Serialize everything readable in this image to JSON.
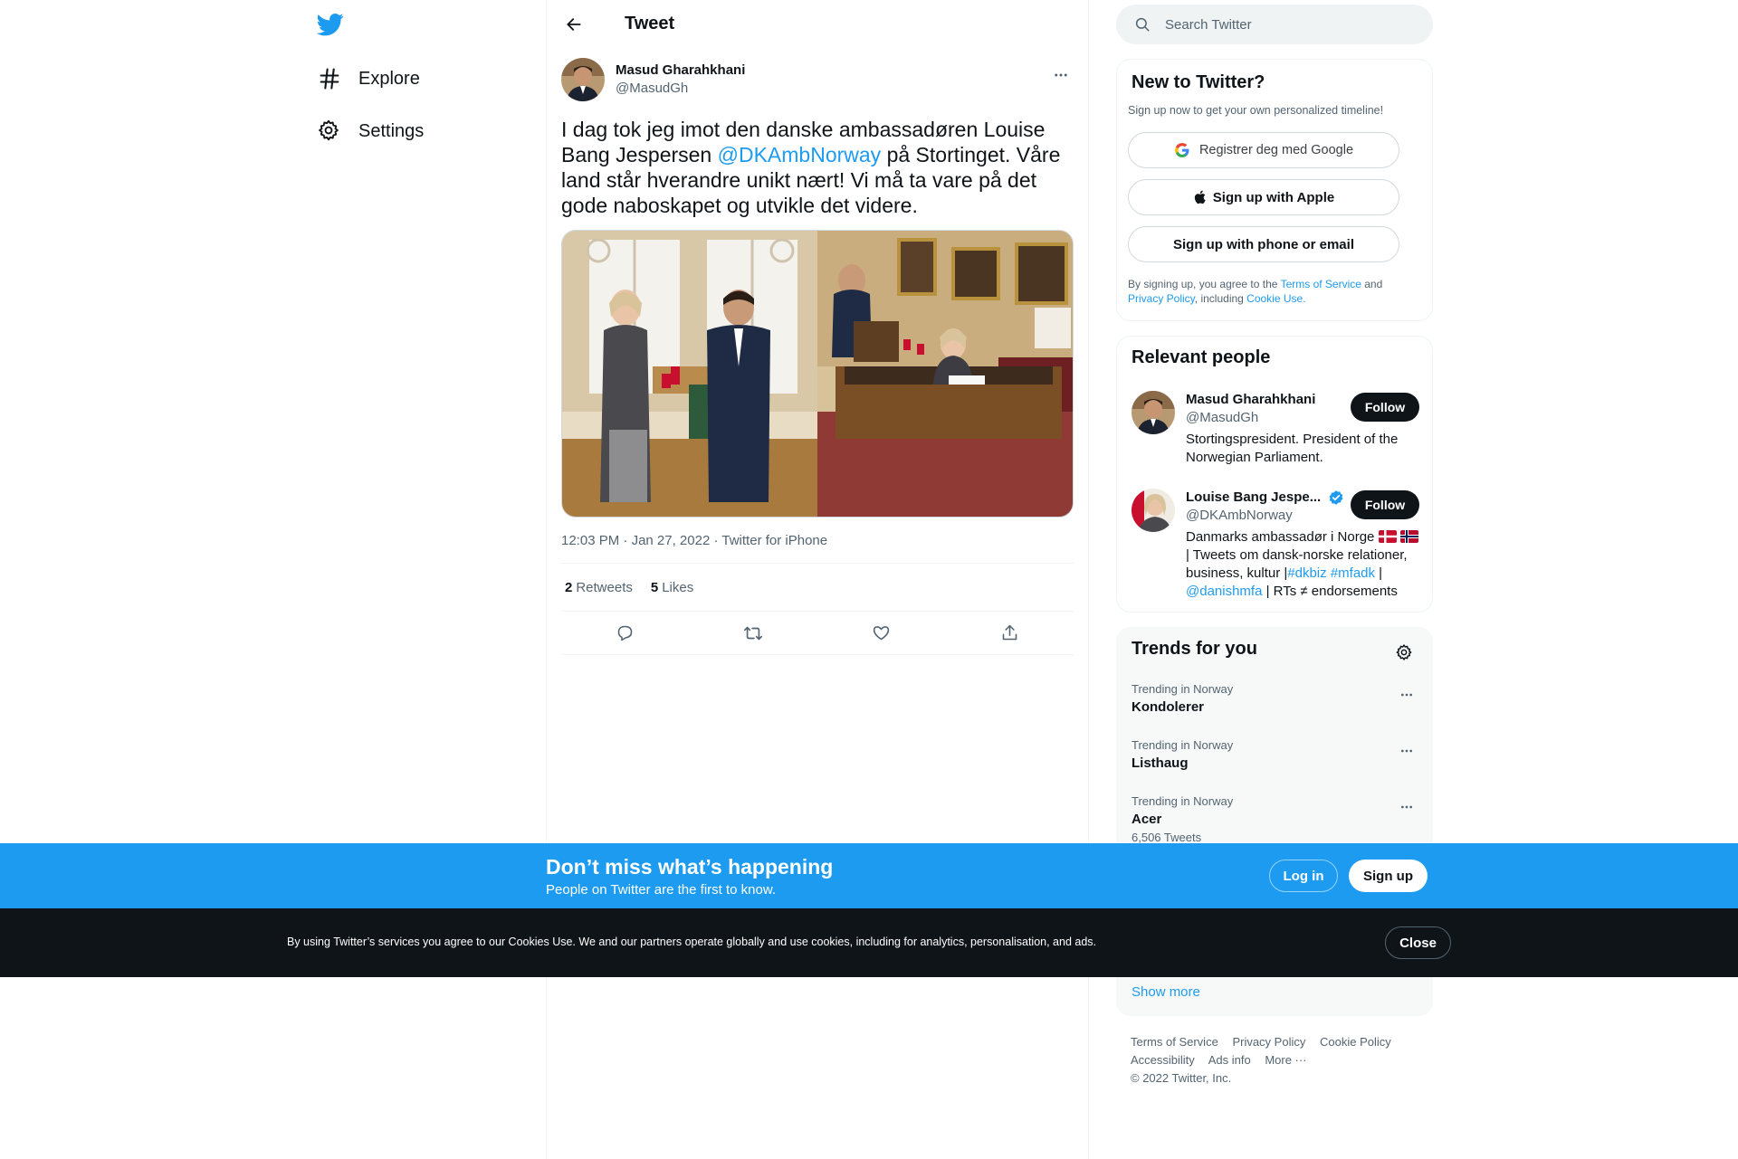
{
  "nav": {
    "logo_icon": "twitter-bird-icon",
    "items": [
      {
        "label": "Explore",
        "icon": "hashtag-icon"
      },
      {
        "label": "Settings",
        "icon": "gear-icon"
      }
    ]
  },
  "header": {
    "title": "Tweet"
  },
  "tweet": {
    "author_name": "Masud Gharahkhani",
    "author_handle": "@MasudGh",
    "text_before": "I dag tok jeg imot den danske ambassadøren Louise Bang Jespersen ",
    "mention": "@DKAmbNorway",
    "text_after": " på Stortinget. Våre land står hverandre unikt nært! Vi må ta vare på det gode naboskapet og utvikle det videre.",
    "time": "12:03 PM",
    "date": "Jan 27, 2022",
    "source": "Twitter for iPhone",
    "separator": "·",
    "retweets_count": "2",
    "retweets_label": "Retweets",
    "likes_count": "5",
    "likes_label": "Likes"
  },
  "search": {
    "placeholder": "Search Twitter"
  },
  "new_to_twitter": {
    "title": "New to Twitter?",
    "subtitle": "Sign up now to get your own personalized timeline!",
    "google_label": "Registrer deg med Google",
    "apple_label": "Sign up with Apple",
    "phone_label": "Sign up with phone or email",
    "legal_prefix": "By signing up, you agree to the ",
    "terms": "Terms of Service",
    "and": " and",
    "privacy": "Privacy Policy",
    "including": ", including ",
    "cookie_use": "Cookie Use."
  },
  "relevant_people": {
    "title": "Relevant people",
    "people": [
      {
        "name": "Masud Gharahkhani",
        "handle": "@MasudGh",
        "bio": "Stortingspresident. President of the Norwegian Parliament.",
        "follow": "Follow"
      },
      {
        "name": "Louise Bang Jespe...",
        "handle": "@DKAmbNorway",
        "bio_1": "Danmarks ambassadør i Norge",
        "bio_2": " | Tweets om dansk-norske relationer, business, kultur |",
        "tag_1": "#dkbiz",
        "tag_2": "#mfadk",
        "bio_3": " |",
        "mention": "@danishmfa",
        "bio_4": " | RTs ≠ endorsements",
        "follow": "Follow",
        "verified": true
      }
    ]
  },
  "trends": {
    "title": "Trends for you",
    "items": [
      {
        "context": "Trending in Norway",
        "name": "Kondolerer",
        "count": ""
      },
      {
        "context": "Trending in Norway",
        "name": "Listhaug",
        "count": ""
      },
      {
        "context": "Trending in Norway",
        "name": "Acer",
        "count": "6,506 Tweets"
      }
    ],
    "show_more": "Show more"
  },
  "footer": {
    "links": [
      "Terms of Service",
      "Privacy Policy",
      "Cookie Policy",
      "Accessibility",
      "Ads info",
      "More ···"
    ],
    "copyright": "© 2022 Twitter, Inc."
  },
  "signup_bar": {
    "title": "Don’t miss what’s happening",
    "subtitle": "People on Twitter are the first to know.",
    "login": "Log in",
    "signup": "Sign up"
  },
  "cookie_bar": {
    "text": "By using Twitter’s services you agree to our Cookies Use. We and our partners operate globally and use cookies, including for analytics, personalisation, and ads.",
    "close": "Close"
  },
  "colors": {
    "brand": "#1d9bf0",
    "text": "#0f1419",
    "muted": "#536471",
    "border": "#eff3f4",
    "dark": "#0f1419"
  }
}
